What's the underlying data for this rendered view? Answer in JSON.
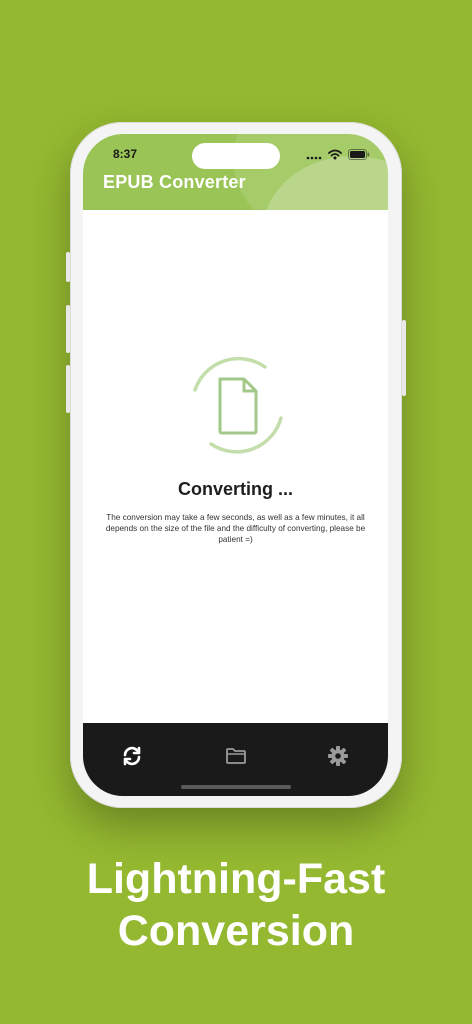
{
  "status_bar": {
    "time": "8:37"
  },
  "app": {
    "title": "EPUB Converter"
  },
  "converting": {
    "title": "Converting ...",
    "description": "The conversion may take a few seconds, as well as a few minutes, it all depends on the size of the file and the difficulty of converting, please be patient =)"
  },
  "tabs": [
    {
      "icon": "sync-icon",
      "active": true
    },
    {
      "icon": "folder-icon",
      "active": false
    },
    {
      "icon": "gear-icon",
      "active": false
    }
  ],
  "headline": {
    "line1": "Lightning-Fast",
    "line2": "Conversion"
  },
  "colors": {
    "background": "#94b830",
    "header": "#9ac455",
    "accent_light": "#b9d88f",
    "tabbar": "#1a1a1a"
  }
}
